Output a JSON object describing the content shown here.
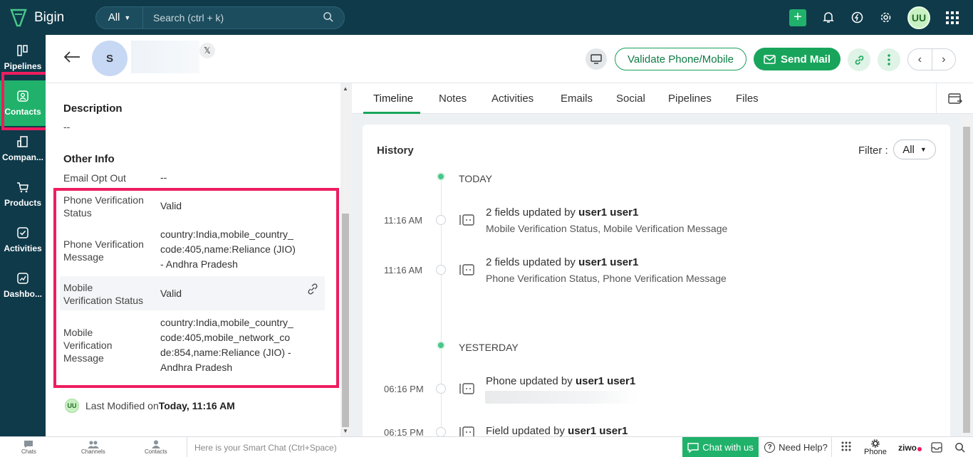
{
  "app": {
    "name": "Bigin"
  },
  "search": {
    "scope": "All",
    "placeholder": "Search (ctrl + k)"
  },
  "user": {
    "initials": "UU"
  },
  "nav": [
    {
      "label": "Pipelines",
      "icon": "pipelines-icon"
    },
    {
      "label": "Contacts",
      "icon": "contacts-icon",
      "active": true
    },
    {
      "label": "Compan...",
      "icon": "companies-icon"
    },
    {
      "label": "Products",
      "icon": "products-icon"
    },
    {
      "label": "Activities",
      "icon": "activities-icon"
    },
    {
      "label": "Dashbo...",
      "icon": "dashboard-icon"
    }
  ],
  "contact": {
    "initial": "S",
    "social_badge": "𝕏"
  },
  "actions": {
    "validate": "Validate Phone/Mobile",
    "send_mail": "Send Mail"
  },
  "details": {
    "description_title": "Description",
    "description_value": "--",
    "other_info_title": "Other Info",
    "email_opt_out_label": "Email Opt Out",
    "email_opt_out_value": "--",
    "phone_ver_status_label_1": "Phone Verification",
    "phone_ver_status_label_2": "Status",
    "phone_ver_status_value": "Valid",
    "phone_ver_msg_label_1": "Phone Verification",
    "phone_ver_msg_label_2": "Message",
    "phone_ver_msg_line1": "country:India,mobile_country_",
    "phone_ver_msg_line2": "code:405,name:Reliance (JIO)",
    "phone_ver_msg_line3": "- Andhra Pradesh",
    "mobile_ver_status_label_1": "Mobile",
    "mobile_ver_status_label_2": "Verification Status",
    "mobile_ver_status_value": "Valid",
    "mobile_ver_msg_label_1": "Mobile",
    "mobile_ver_msg_label_2": "Verification",
    "mobile_ver_msg_label_3": "Message",
    "mobile_ver_msg_line1": "country:India,mobile_country_",
    "mobile_ver_msg_line2": "code:405,mobile_network_co",
    "mobile_ver_msg_line3": "de:854,name:Reliance (JIO) -",
    "mobile_ver_msg_line4": "Andhra Pradesh",
    "last_modified_label": "Last Modified on",
    "last_modified_value": "Today, 11:16 AM"
  },
  "tabs": [
    "Timeline",
    "Notes",
    "Activities",
    "Emails",
    "Social",
    "Pipelines",
    "Files"
  ],
  "history": {
    "title": "History",
    "filter_label": "Filter :",
    "filter_value": "All",
    "today": "TODAY",
    "yesterday": "YESTERDAY",
    "events": [
      {
        "time": "11:16 AM",
        "prefix": "2 fields updated by ",
        "user": "user1 user1",
        "sub": "Mobile Verification Status, Mobile Verification Message"
      },
      {
        "time": "11:16 AM",
        "prefix": "2 fields updated by ",
        "user": "user1 user1",
        "sub": "Phone Verification Status, Phone Verification Message"
      },
      {
        "time": "06:16 PM",
        "prefix": "Phone updated by ",
        "user": "user1 user1",
        "sub": ""
      },
      {
        "time": "06:15 PM",
        "prefix": "Field updated by ",
        "user": "user1 user1",
        "sub": ""
      }
    ]
  },
  "bottom": {
    "chats": "Chats",
    "channels": "Channels",
    "contacts": "Contacts",
    "smartchat_placeholder": "Here is your Smart Chat (Ctrl+Space)",
    "chat_with_us": "Chat with us",
    "need_help": "Need Help?",
    "phone": "Phone",
    "ziwo": "ziwo"
  },
  "colors": {
    "brand_dark": "#0f3a4a",
    "accent_green": "#18a55b",
    "highlight_red": "#ee1d5f"
  }
}
